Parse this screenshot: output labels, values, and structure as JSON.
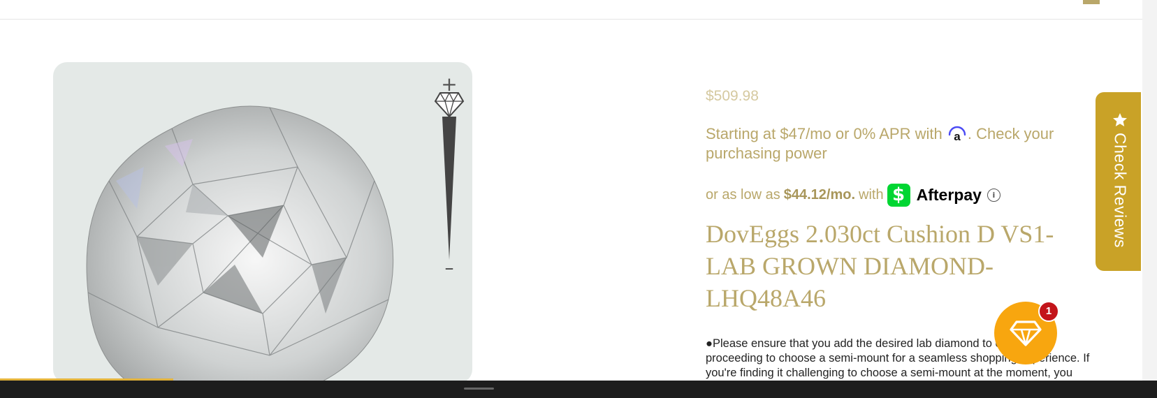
{
  "product": {
    "price": "$509.98",
    "financing": {
      "prefix": "Starting at $47/mo or 0% APR with",
      "provider_icon": "affirm-logo-icon",
      "suffix": ". Check your purchasing power"
    },
    "afterpay": {
      "prefix": "or as low as",
      "amount": "$44.12/mo.",
      "with": "with",
      "badge_icon": "cash-app-icon",
      "badge_glyph": "$",
      "brand": "Afterpay",
      "info_icon": "info-icon",
      "info_glyph": "i"
    },
    "title": "DovEggs 2.030ct Cushion D VS1-LAB GROWN DIAMOND-LHQ48A46",
    "notice": "●Please ensure that you add the desired lab diamond to cart before proceeding to choose a semi-mount for a seamless shopping experience. If you're finding it challenging to choose a semi-mount at the moment, you"
  },
  "gallery": {
    "image_icon": "diamond-photo",
    "zoom_in": "+",
    "zoom_out": "–",
    "zoom_level": 0,
    "slider_icon": "diamond-icon"
  },
  "reviews_tab": {
    "label": "Check Reviews",
    "icon": "star-icon"
  },
  "fab": {
    "icon": "gem-icon",
    "badge": "1"
  },
  "page_scroll_progress": 0.15,
  "colors": {
    "gold": "#b9a76a",
    "price_light": "#d5c9a0",
    "reviews_tab": "#c9a227",
    "fab": "#f8a60f",
    "badge": "#c3141a",
    "cash_app": "#00d632",
    "bottom_bar": "#1d1d1d"
  }
}
